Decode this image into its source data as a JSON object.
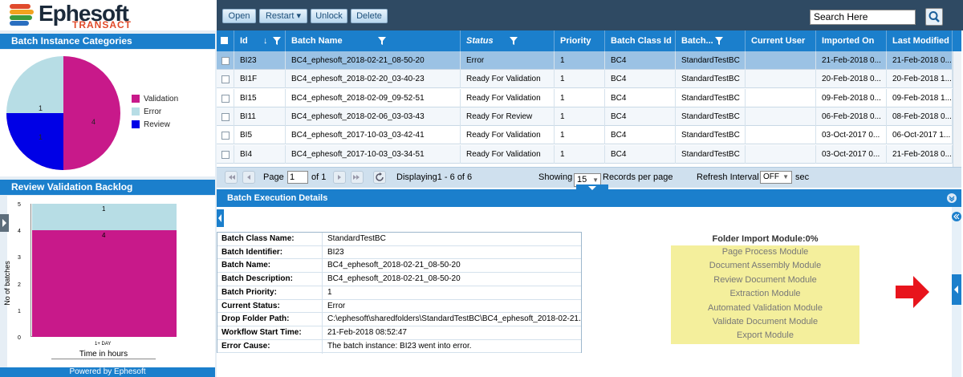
{
  "app": {
    "logo_name": "Ephesoft",
    "logo_sub": "TRANSACT",
    "brand_color": "#1b7fcc"
  },
  "toolbar": {
    "open": "Open",
    "restart": "Restart ▾",
    "unlock": "Unlock",
    "delete": "Delete"
  },
  "search": {
    "value": "Search Here"
  },
  "categories": {
    "title": "Batch Instance Categories",
    "legend": [
      {
        "label": "Validation",
        "color": "#c8198a",
        "value": 4
      },
      {
        "label": "Error",
        "color": "#b7dde5",
        "value": 1
      },
      {
        "label": "Review",
        "color": "#0000e6",
        "value": 1
      }
    ],
    "slice_labels": [
      "4",
      "1",
      "1"
    ]
  },
  "backlog": {
    "title": "Review Validation Backlog",
    "ylabel": "No of batches",
    "xlabel": "Time in hours",
    "yticks": [
      "5",
      "4",
      "3",
      "2",
      "1",
      "0"
    ],
    "category": "1+ DAY",
    "seg_labels": [
      "4",
      "1"
    ],
    "footer": "Powered by Ephesoft"
  },
  "grid": {
    "headers": [
      "Id",
      "Batch Name",
      "Status",
      "Priority",
      "Batch Class Id",
      "Batch...",
      "Current User",
      "Imported On",
      "Last Modified"
    ],
    "rows": [
      {
        "id": "BI23",
        "name": "BC4_ephesoft_2018-02-21_08-50-20",
        "status": "Error",
        "priority": "1",
        "class_id": "BC4",
        "batch": "StandardTestBC",
        "user": "",
        "imported": "21-Feb-2018 0...",
        "modified": "21-Feb-2018 0..."
      },
      {
        "id": "BI1F",
        "name": "BC4_ephesoft_2018-02-20_03-40-23",
        "status": "Ready For Validation",
        "priority": "1",
        "class_id": "BC4",
        "batch": "StandardTestBC",
        "user": "",
        "imported": "20-Feb-2018 0...",
        "modified": "20-Feb-2018 1..."
      },
      {
        "id": "BI15",
        "name": "BC4_ephesoft_2018-02-09_09-52-51",
        "status": "Ready For Validation",
        "priority": "1",
        "class_id": "BC4",
        "batch": "StandardTestBC",
        "user": "",
        "imported": "09-Feb-2018 0...",
        "modified": "09-Feb-2018 1..."
      },
      {
        "id": "BI11",
        "name": "BC4_ephesoft_2018-02-06_03-03-43",
        "status": "Ready For Review",
        "priority": "1",
        "class_id": "BC4",
        "batch": "StandardTestBC",
        "user": "",
        "imported": "06-Feb-2018 0...",
        "modified": "08-Feb-2018 0..."
      },
      {
        "id": "BI5",
        "name": "BC4_ephesoft_2017-10-03_03-42-41",
        "status": "Ready For Validation",
        "priority": "1",
        "class_id": "BC4",
        "batch": "StandardTestBC",
        "user": "",
        "imported": "03-Oct-2017 0...",
        "modified": "06-Oct-2017 1..."
      },
      {
        "id": "BI4",
        "name": "BC4_ephesoft_2017-10-03_03-34-51",
        "status": "Ready For Validation",
        "priority": "1",
        "class_id": "BC4",
        "batch": "StandardTestBC",
        "user": "",
        "imported": "03-Oct-2017 0...",
        "modified": "21-Feb-2018 0..."
      }
    ]
  },
  "pager": {
    "page_label": "Page",
    "page_value": "1",
    "of": "of 1",
    "displaying": "Displaying1 - 6 of 6",
    "showing": "Showing",
    "per_page_value": "15",
    "records": "Records per page",
    "refresh": "Refresh Interval",
    "refresh_value": "OFF",
    "sec": "sec"
  },
  "exec": {
    "title": "Batch Execution Details",
    "details": [
      {
        "label": "Batch Class Name:",
        "value": "StandardTestBC"
      },
      {
        "label": "Batch Identifier:",
        "value": "BI23"
      },
      {
        "label": "Batch Name:",
        "value": "BC4_ephesoft_2018-02-21_08-50-20"
      },
      {
        "label": "Batch Description:",
        "value": "BC4_ephesoft_2018-02-21_08-50-20"
      },
      {
        "label": "Batch Priority:",
        "value": "1"
      },
      {
        "label": "Current Status:",
        "value": "Error"
      },
      {
        "label": "Drop Folder Path:",
        "value": "C:\\ephesoft\\sharedfolders\\StandardTestBC\\BC4_ephesoft_2018-02-21..."
      },
      {
        "label": "Workflow Start Time:",
        "value": "21-Feb-2018 08:52:47"
      },
      {
        "label": "Error Cause:",
        "value": "The batch instance: BI23 went into error."
      }
    ],
    "module_title": "Folder Import Module:0%",
    "modules": [
      "Page Process Module",
      "Document Assembly Module",
      "Review Document Module",
      "Extraction Module",
      "Automated Validation Module",
      "Validate Document Module",
      "Export Module"
    ]
  }
}
